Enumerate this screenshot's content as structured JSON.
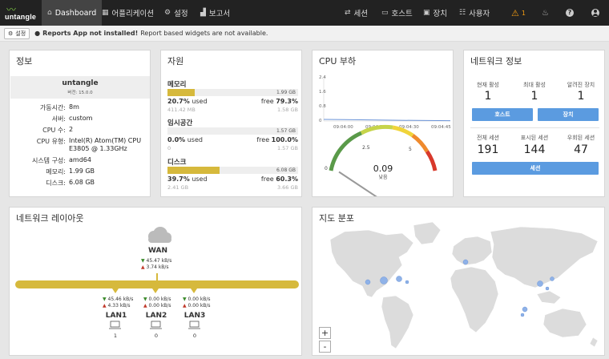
{
  "brand": {
    "name": "untangle"
  },
  "nav": {
    "dashboard": "Dashboard",
    "apps": "어플리케이션",
    "settings": "설정",
    "reports": "보고서",
    "sessions": "세션",
    "hosts": "호스트",
    "devices": "장치",
    "users": "사용자",
    "alert_count": "1"
  },
  "alertbar": {
    "settings_label": "설정",
    "strong": "Reports App not installed!",
    "text": "Report based widgets are not available."
  },
  "info": {
    "title": "정보",
    "hostname": "untangle",
    "version": "버전: 15.0.0",
    "rows": [
      {
        "k": "가동시간:",
        "v": "8m"
      },
      {
        "k": "서버:",
        "v": "custom"
      },
      {
        "k": "CPU 수:",
        "v": "2"
      },
      {
        "k": "CPU 유형:",
        "v": "Intel(R) Atom(TM) CPU E3805 @ 1.33GHz"
      },
      {
        "k": "시스템 구성:",
        "v": "amd64"
      },
      {
        "k": "메모리:",
        "v": "1.99 GB"
      },
      {
        "k": "디스크:",
        "v": "6.08 GB"
      }
    ]
  },
  "resources": {
    "title": "자원",
    "items": [
      {
        "label": "메모리",
        "total": "1.99 GB",
        "fill": 0.207,
        "used_pct": "20.7%",
        "used_word": "used",
        "free_word": "free",
        "free_pct": "79.3%",
        "used_amt": "411.42 MB",
        "free_amt": "1.58 GB"
      },
      {
        "label": "임시공간",
        "total": "1.57 GB",
        "fill": 0.0,
        "used_pct": "0.0%",
        "used_word": "used",
        "free_word": "free",
        "free_pct": "100.0%",
        "used_amt": "0",
        "free_amt": "1.57 GB"
      },
      {
        "label": "디스크",
        "total": "6.08 GB",
        "fill": 0.397,
        "used_pct": "39.7%",
        "used_word": "used",
        "free_word": "free",
        "free_pct": "60.3%",
        "used_amt": "2.41 GB",
        "free_amt": "3.66 GB"
      }
    ]
  },
  "cpu": {
    "title": "CPU 부하",
    "yticks": [
      "2.4",
      "1.6",
      "0.8",
      "0"
    ],
    "xticks": [
      "09:04:00",
      "09:04:15",
      "09:04:30",
      "09:04:45"
    ],
    "gauge_ticks": [
      "0",
      "2.5",
      "5"
    ],
    "value": "0.09",
    "value_num": 0.09,
    "status": "낮음"
  },
  "netinfo": {
    "title": "네트워크 정보",
    "row1": [
      {
        "label": "현재 활성",
        "value": "1"
      },
      {
        "label": "최대 활성",
        "value": "1"
      },
      {
        "label": "알려진 장치",
        "value": "1"
      }
    ],
    "hosts_btn": "호스트",
    "devices_btn": "장치",
    "row2": [
      {
        "label": "전체 세션",
        "value": "191"
      },
      {
        "label": "표시된 세션",
        "value": "144"
      },
      {
        "label": "우회된 세션",
        "value": "47"
      }
    ],
    "sessions_btn": "세션"
  },
  "netlayout": {
    "title": "네트워크 레이아웃",
    "wan": {
      "label": "WAN",
      "down": "45.47 kB/s",
      "up": "3.74 kB/s"
    },
    "lans": [
      {
        "label": "LAN1",
        "down": "45.46 kB/s",
        "up": "4.33 kB/s",
        "count": "1"
      },
      {
        "label": "LAN2",
        "down": "0.00 kB/s",
        "up": "0.00 kB/s",
        "count": "0"
      },
      {
        "label": "LAN3",
        "down": "0.00 kB/s",
        "up": "0.00 kB/s",
        "count": "0"
      }
    ]
  },
  "map": {
    "title": "지도 분포",
    "zoom_in": "+",
    "zoom_out": "-"
  },
  "colors": {
    "bar_fill": "#d6b93c",
    "button": "#5b9be0",
    "topbar": "#222222",
    "alert": "#f39c12"
  }
}
